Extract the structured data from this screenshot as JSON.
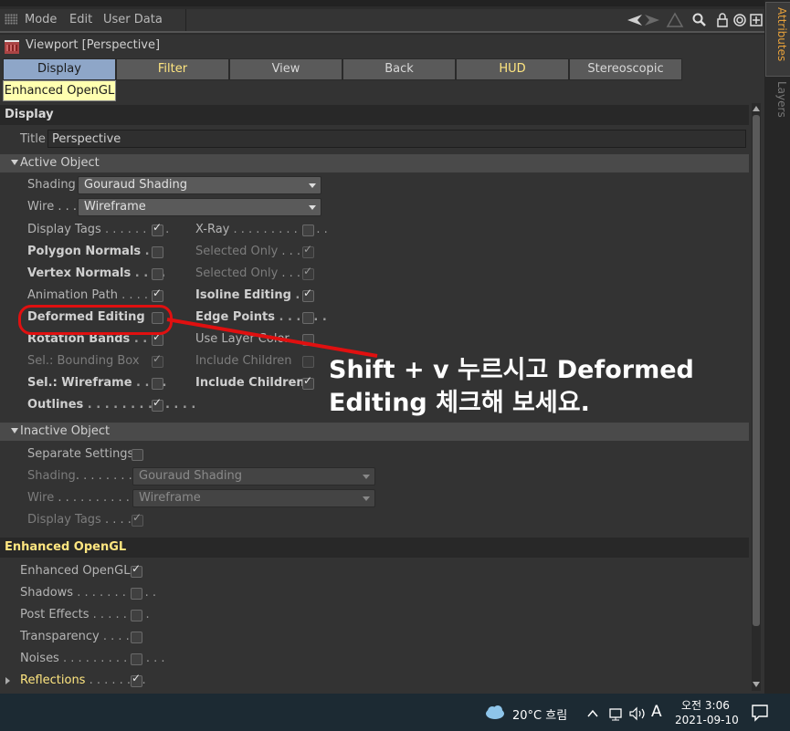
{
  "menu": {
    "mode": "Mode",
    "edit": "Edit",
    "user_data": "User Data"
  },
  "viewport_title": "Viewport [Perspective]",
  "tabs": [
    "Display",
    "Filter",
    "View",
    "Back",
    "HUD",
    "Stereoscopic"
  ],
  "subtab": "Enhanced OpenGL",
  "display": {
    "header": "Display",
    "title_label": "Title",
    "title_value": "Perspective",
    "active_object": {
      "header": "Active Object",
      "shading_label": "Shading",
      "shading_value": "Gouraud Shading",
      "wire_label": "Wire . . .",
      "wire_value": "Wireframe",
      "left": [
        {
          "label": "Display Tags",
          "dots": " . . . . . . . . .",
          "checked": true,
          "style": "normal"
        },
        {
          "label": "Polygon Normals",
          "dots": " . ",
          "checked": false,
          "style": "bold"
        },
        {
          "label": "Vertex Normals",
          "dots": " . . . . ",
          "checked": false,
          "style": "bold"
        },
        {
          "label": "Animation Path",
          "dots": " . . . . . .",
          "checked": true,
          "style": "normal"
        },
        {
          "label": "Deformed Editing",
          "dots": " ",
          "checked": false,
          "style": "bold"
        },
        {
          "label": "Rotation Bands",
          "dots": " . .",
          "checked": true,
          "style": "bold"
        },
        {
          "label": "Sel.: Bounding Box",
          "dots": "",
          "checked": true,
          "style": "dim"
        },
        {
          "label": "Sel.: Wireframe",
          "dots": " . . . .",
          "checked": false,
          "style": "bold"
        },
        {
          "label": "Outlines",
          "dots": " . . . . . . . . . . . . .",
          "checked": true,
          "style": "bold"
        }
      ],
      "right": [
        {
          "label": "X-Ray",
          "dots": " . . . . . . . . . . . . .",
          "checked": false,
          "style": "normal"
        },
        {
          "label": "Selected Only",
          "dots": " . . .",
          "checked": true,
          "style": "dim"
        },
        {
          "label": "Selected Only",
          "dots": " . . .",
          "checked": true,
          "style": "dim"
        },
        {
          "label": "Isoline Editing",
          "dots": " . .",
          "checked": true,
          "style": "bold"
        },
        {
          "label": "Edge Points",
          "dots": " . . . . . .",
          "checked": false,
          "style": "bold"
        },
        {
          "label": "Use Layer Color",
          "dots": "",
          "checked": false,
          "style": "normal"
        },
        {
          "label": "Include Children",
          "dots": "",
          "checked": false,
          "style": "dim"
        },
        {
          "label": "Include Children",
          "dots": "",
          "checked": true,
          "style": "bold"
        }
      ]
    },
    "inactive_object": {
      "header": "Inactive Object",
      "separate_label": "Separate Settings",
      "shading_label": "Shading",
      "shading_dots": ". . . . . . . . . . . .",
      "shading_value": "Gouraud Shading",
      "wire_label": "Wire",
      "wire_dots": " . . . . . . . . . . . . .",
      "wire_value": "Wireframe",
      "tags_label": "Display Tags",
      "tags_dots": " . . . . ."
    }
  },
  "enhanced": {
    "header": "Enhanced OpenGL",
    "items": [
      {
        "label": "Enhanced OpenGL",
        "dots": "",
        "checked": true,
        "style": "normal"
      },
      {
        "label": "Shadows",
        "dots": " . . . . . . . . . . .",
        "checked": false,
        "style": "normal"
      },
      {
        "label": "Post Effects",
        "dots": " . . . . . . . .",
        "checked": false,
        "style": "normal"
      },
      {
        "label": "Transparency",
        "dots": " . . . . .",
        "checked": false,
        "style": "normal"
      },
      {
        "label": "Noises",
        "dots": " . . . . . . . . . . . . . .",
        "checked": false,
        "style": "normal"
      },
      {
        "label": "Reflections",
        "dots": " . . . . . . . .",
        "checked": true,
        "style": "ylw"
      }
    ]
  },
  "side_tabs": {
    "attributes": "Attributes",
    "layers": "Layers"
  },
  "annotation": {
    "line1": "Shift + v 누르시고 Deformed",
    "line2": "Editing 체크해 보세요."
  },
  "taskbar": {
    "weather": "20°C  흐림",
    "time": "오전 3:06",
    "date": "2021-09-10",
    "ime": "A"
  },
  "colors": {
    "accent": "#8ea6c8",
    "highlight": "#ffe680",
    "annotation": "#e01010"
  }
}
